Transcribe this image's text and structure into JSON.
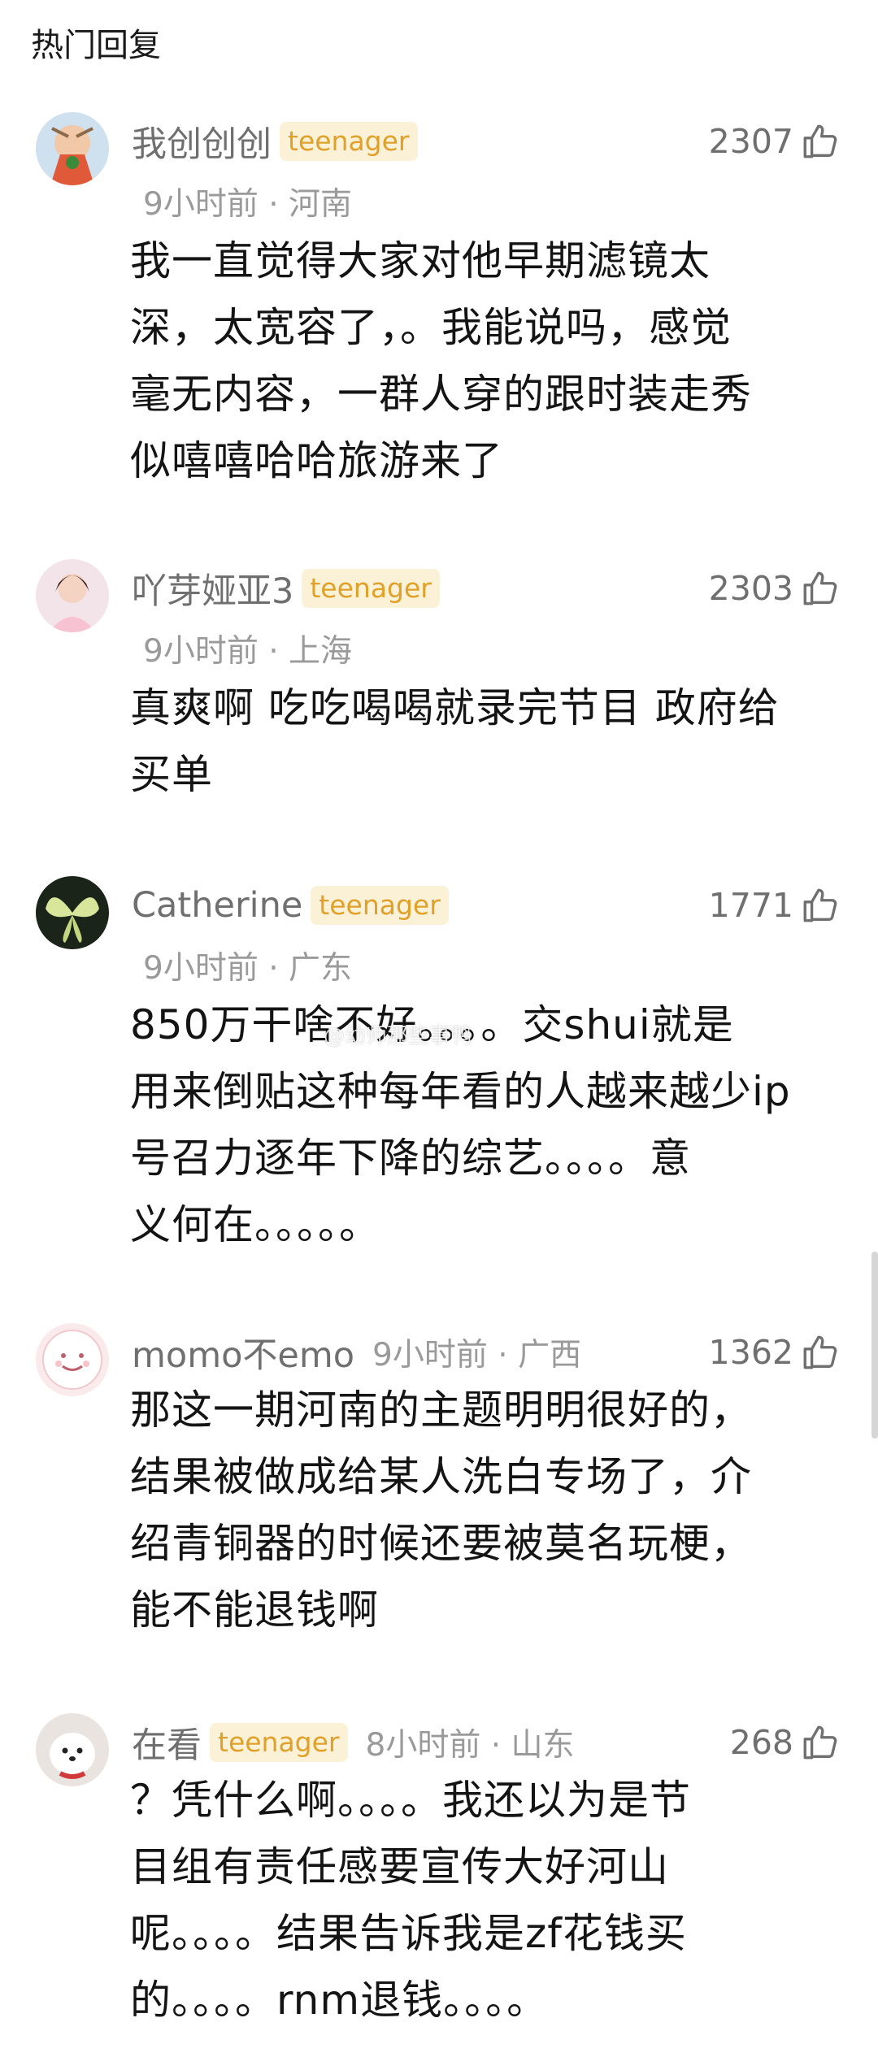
{
  "section": {
    "title": "热门回复"
  },
  "watermark": "@幼师那些事鸭",
  "comments": [
    {
      "username": "我创创创",
      "badge": "teenager",
      "time": "9小时前",
      "location": "河南",
      "likes": "2307",
      "text": "我一直觉得大家对他早期滤镜太\n深，太宽容了，。我能说吗，感觉\n毫无内容，一群人穿的跟时装走秀\n似嘻嘻哈哈旅游来了"
    },
    {
      "username": "吖芽娅亚3",
      "badge": "teenager",
      "time": "9小时前",
      "location": "上海",
      "likes": "2303",
      "text": "真爽啊 吃吃喝喝就录完节目 政府给\n买单"
    },
    {
      "username": "Catherine",
      "badge": "teenager",
      "time": "9小时前",
      "location": "广东",
      "likes": "1771",
      "text": "850万干啥不好。。。。交shui就是\n用来倒贴这种每年看的人越来越少ip\n号召力逐年下降的综艺。。。。意\n义何在。。。。。"
    },
    {
      "username": "momo不emo",
      "time": "9小时前",
      "location": "广西",
      "likes": "1362",
      "text": "那这一期河南的主题明明很好的，\n结果被做成给某人洗白专场了，介\n绍青铜器的时候还要被莫名玩梗，\n能不能退钱啊"
    },
    {
      "username": "在看",
      "badge": "teenager",
      "time": "8小时前",
      "location": "山东",
      "likes": "268",
      "text": "？凭什么啊。。。。我还以为是节\n目组有责任感要宣传大好河山\n呢。。。。结果告诉我是zf花钱买\n的。。。。rnm退钱。。。。"
    }
  ]
}
